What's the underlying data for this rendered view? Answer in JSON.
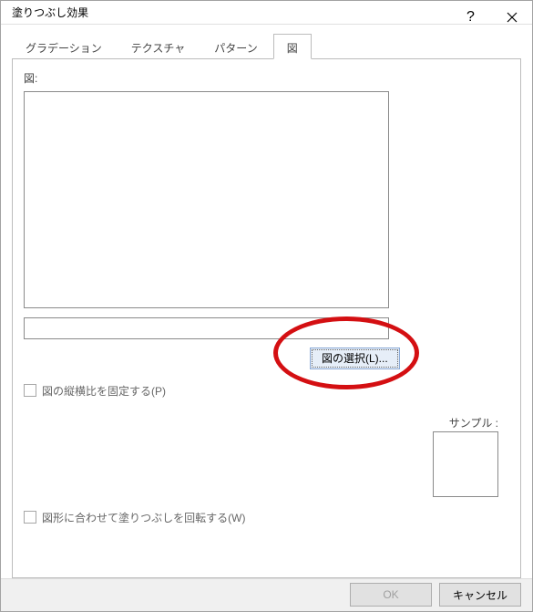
{
  "window": {
    "title": "塗りつぶし効果"
  },
  "tabs": [
    {
      "label": "グラデーション"
    },
    {
      "label": "テクスチャ"
    },
    {
      "label": "パターン"
    },
    {
      "label": "図"
    }
  ],
  "active_tab_index": 3,
  "panel": {
    "picture_label": "図:",
    "select_picture_button": "図の選択(L)...",
    "lock_aspect_label": "図の縦横比を固定する(P)",
    "rotate_with_shape_label": "図形に合わせて塗りつぶしを回転する(W)",
    "sample_label": "サンプル :"
  },
  "footer": {
    "ok": "OK",
    "cancel": "キャンセル"
  }
}
